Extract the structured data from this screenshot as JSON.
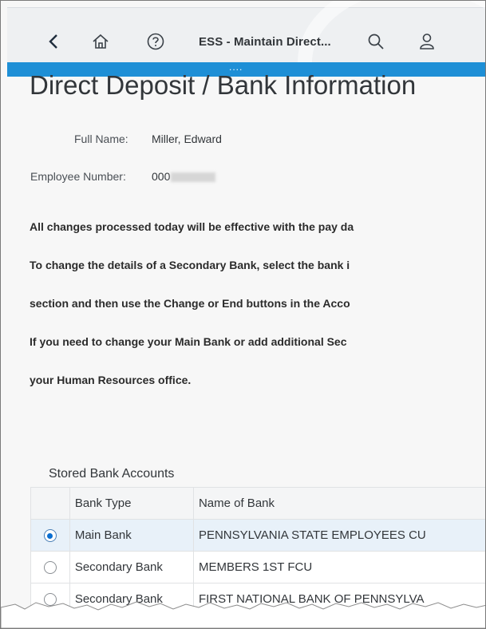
{
  "shell": {
    "title": "ESS - Maintain Direct...",
    "icons": [
      "back-icon",
      "home-icon",
      "help-icon",
      "search-icon",
      "user-icon"
    ],
    "handle": "...."
  },
  "page": {
    "title": "Direct Deposit / Bank Information",
    "full_name_label": "Full Name:",
    "full_name": "Miller, Edward",
    "employee_number_label": "Employee Number:",
    "employee_number": "000"
  },
  "info": {
    "line1": "All changes processed today will be effective with the pay da",
    "line2": "To change the details of a Secondary Bank, select the bank i",
    "line3": "section and then use the Change or End buttons in the Acco",
    "line4": "If you need to change your Main Bank or add additional Sec",
    "line5": "your Human Resources office."
  },
  "accounts": {
    "title": "Stored Bank Accounts",
    "columns": [
      "",
      "Bank Type",
      "Name of Bank"
    ],
    "rows": [
      {
        "selected": true,
        "bank_type": "Main Bank",
        "name": "PENNSYLVANIA STATE EMPLOYEES CU"
      },
      {
        "selected": false,
        "bank_type": "Secondary Bank",
        "name": "MEMBERS 1ST FCU"
      },
      {
        "selected": false,
        "bank_type": "Secondary Bank",
        "name": "FIRST NATIONAL BANK OF PENNSYLVA"
      }
    ]
  },
  "colors": {
    "accent": "#1e8fd6",
    "selected_radio": "#0a6ed1",
    "selected_row": "#e8f1f9"
  }
}
